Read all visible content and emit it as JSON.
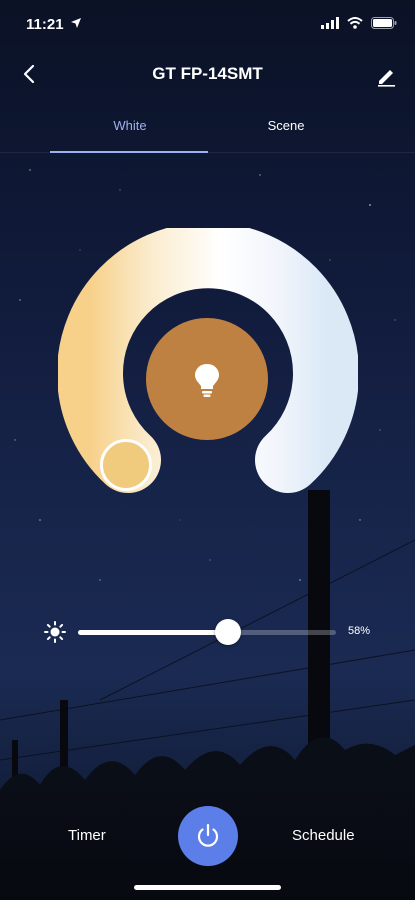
{
  "status_bar": {
    "time": "11:21"
  },
  "header": {
    "title": "GT FP-14SMT"
  },
  "tabs": [
    {
      "label": "White",
      "active": true
    },
    {
      "label": "Scene",
      "active": false
    }
  ],
  "brightness": {
    "value": 0.58,
    "label": "58%"
  },
  "color_temperature": {
    "knob_color": "#f0cb7d",
    "center_color": "#bf8142"
  },
  "bottom_bar": {
    "timer_label": "Timer",
    "schedule_label": "Schedule"
  },
  "colors": {
    "accent": "#9fb0ee",
    "power_button": "#5c7ee8"
  },
  "icons": [
    "location-arrow-icon",
    "signal-icon",
    "wifi-icon",
    "battery-icon",
    "back-chevron-icon",
    "edit-pencil-icon",
    "bulb-icon",
    "sun-icon",
    "power-icon"
  ]
}
